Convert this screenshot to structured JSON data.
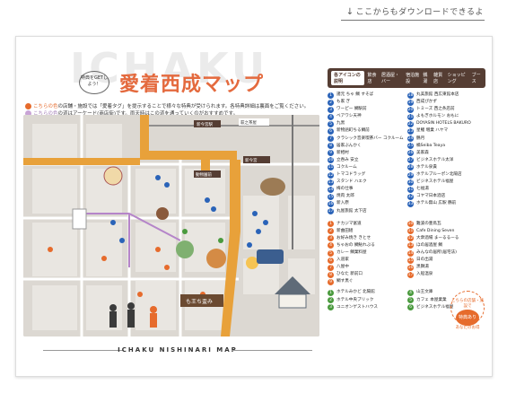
{
  "download_note": "ここからもダウンロードできるよ",
  "title": "愛着西成マップ",
  "background_word": "ICHAKU",
  "tag_bubble": "特典をGETしよう！",
  "notes": [
    {
      "marker": "こちらの色",
      "text": "の店舗・施設では「愛着タグ」を提示することで様々な特典が受けられます。各特典詳細は裏面をご覧ください。",
      "color": "#e66b2c"
    },
    {
      "marker": "こちらの色",
      "text": "の道はアーケード(商店街)です。雨天時はこの道を通っていくのがおすすめです。",
      "color": "#c9a4d6"
    }
  ],
  "map_labels": {
    "station_1": "新今宮駅",
    "station_2": "新今宮駅前",
    "station_3": "動物園前",
    "station_4": "萩之茶屋",
    "station_5": "新今宮",
    "station_6": "新今宮駅",
    "sign": "も王ち盃み"
  },
  "caption": "ICHAKU NISHINARI MAP",
  "legend": {
    "head_title": "各アイコンの説明",
    "head_icons": [
      "飲食店",
      "居酒屋・バー",
      "宿泊施設",
      "銭湯",
      "雑貨店",
      "ショッピング",
      "ブース"
    ],
    "blue_left": [
      {
        "n": "1",
        "label": "諸元 ちゃ 鯛 すそば"
      },
      {
        "n": "2",
        "label": "も家 ぎ"
      },
      {
        "n": "3",
        "label": "ワーピー 鯛駅前"
      },
      {
        "n": "4",
        "label": "ベアワシ天神"
      },
      {
        "n": "5",
        "label": "九黒"
      },
      {
        "n": "6",
        "label": "新物語町ちる鯛前"
      },
      {
        "n": "7",
        "label": "クラシック音楽喫茶バー コクルーム"
      },
      {
        "n": "8",
        "label": "居家ぶんかく"
      },
      {
        "n": "9",
        "label": "新相村"
      },
      {
        "n": "10",
        "label": "立吞み 安立"
      },
      {
        "n": "11",
        "label": "コクルーム"
      },
      {
        "n": "12",
        "label": "トマコドラッグ"
      },
      {
        "n": "13",
        "label": "スタンド ハエク"
      },
      {
        "n": "14",
        "label": "梅の仕事"
      },
      {
        "n": "15",
        "label": "焼肉 太郎"
      },
      {
        "n": "16",
        "label": "新入原"
      },
      {
        "n": "17",
        "label": "丸屋旅館 太下店"
      }
    ],
    "blue_right": [
      {
        "n": "18",
        "label": "丸美旅館 西広東館本店"
      },
      {
        "n": "19",
        "label": "西成ぴかず"
      },
      {
        "n": "20",
        "label": "トミーズ 西之条店前"
      },
      {
        "n": "21",
        "label": "よもぎホルモン おもに"
      },
      {
        "n": "22",
        "label": "DOYASIN HOTELS BAKURO"
      },
      {
        "n": "23",
        "label": "星鯉 増業 ハヤマ"
      },
      {
        "n": "24",
        "label": "鶴月"
      },
      {
        "n": "25",
        "label": "橘Seiba Teaya"
      },
      {
        "n": "26",
        "label": "美家森"
      },
      {
        "n": "27",
        "label": "ビジネスホテル太洋"
      },
      {
        "n": "28",
        "label": "ホテル泉貴"
      },
      {
        "n": "29",
        "label": "ホテルブルーポン北陽店"
      },
      {
        "n": "30",
        "label": "ビジネスホテル福屋"
      },
      {
        "n": "31",
        "label": "七福湯"
      },
      {
        "n": "32",
        "label": "コヤマ日本酒店"
      },
      {
        "n": "33",
        "label": "ホテル無山 広駅 鶴前"
      }
    ],
    "orange_left": [
      {
        "n": "1",
        "label": "ナカジマ富道"
      },
      {
        "n": "2",
        "label": "新曲田組"
      },
      {
        "n": "3",
        "label": "お好み焼き きとせ"
      },
      {
        "n": "4",
        "label": "ちゃおの 鯛鮎れぶる"
      },
      {
        "n": "5",
        "label": "カレー 鯛業料屋"
      },
      {
        "n": "6",
        "label": "入道家"
      },
      {
        "n": "7",
        "label": "八屋中"
      },
      {
        "n": "8",
        "label": "ひなた 新前口"
      },
      {
        "n": "9",
        "label": "鯛す黒ぐ"
      }
    ],
    "orange_right": [
      {
        "n": "10",
        "label": "難波の豊鳥瓦"
      },
      {
        "n": "11",
        "label": "Cafe Dining Seven"
      },
      {
        "n": "12",
        "label": "大衆酒場 まーるるーる"
      },
      {
        "n": "13",
        "label": "ほの居酒屋 鯛"
      },
      {
        "n": "14",
        "label": "みんなの居所(居宅法)"
      },
      {
        "n": "15",
        "label": "日の出湯"
      },
      {
        "n": "16",
        "label": "黒獅湯"
      },
      {
        "n": "17",
        "label": "入船温泉"
      }
    ],
    "green_left": [
      {
        "n": "1",
        "label": "ホテルみかど 北陽館"
      },
      {
        "n": "2",
        "label": "ホテル中央ブリック"
      },
      {
        "n": "3",
        "label": "ユニオンゲストハウス"
      }
    ],
    "green_right": [
      {
        "n": "4",
        "label": "山王文庫"
      },
      {
        "n": "5",
        "label": "カフェ 本屋業業"
      },
      {
        "n": "6",
        "label": "ビジネスホテル福屋"
      }
    ],
    "badge": {
      "top": "こちらの店舗・施設で",
      "center": "特典あり",
      "bottom": "あなたのお得"
    }
  }
}
